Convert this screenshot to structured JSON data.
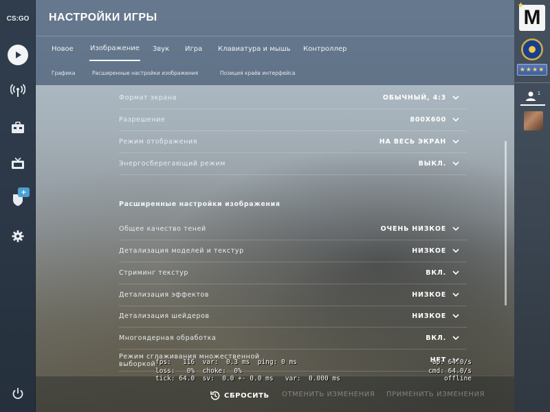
{
  "app": {
    "logo": "CS:GO",
    "page_title": "НАСТРОЙКИ ИГРЫ"
  },
  "left_nav": {
    "items": [
      {
        "icon": "play-icon"
      },
      {
        "icon": "broadcast-icon"
      },
      {
        "icon": "inventory-icon"
      },
      {
        "icon": "tv-icon"
      },
      {
        "icon": "shield-icon",
        "badge": "+"
      },
      {
        "icon": "gear-icon"
      }
    ],
    "power_icon": "power-icon"
  },
  "tabs": [
    {
      "label": "Новое",
      "active": false
    },
    {
      "label": "Изображение",
      "active": true
    },
    {
      "label": "Звук",
      "active": false
    },
    {
      "label": "Игра",
      "active": false
    },
    {
      "label": "Клавиатура и мышь",
      "active": false
    },
    {
      "label": "Контроллер",
      "active": false
    }
  ],
  "subtabs": [
    {
      "label": "Графика"
    },
    {
      "label": "Расширенные настройки изображения"
    },
    {
      "label": "Позиция краёв интерфейса"
    }
  ],
  "basic_settings": [
    {
      "label": "Формат экрана",
      "value": "ОБЫЧНЫЙ, 4:3"
    },
    {
      "label": "Разрешение",
      "value": "800X600"
    },
    {
      "label": "Режим отображения",
      "value": "НА ВЕСЬ ЭКРАН"
    },
    {
      "label": "Энергосберегающий режим",
      "value": "ВЫКЛ."
    }
  ],
  "advanced_section_title": "Расширенные настройки изображения",
  "advanced_settings": [
    {
      "label": "Общее качество теней",
      "value": "ОЧЕНЬ НИЗКОЕ"
    },
    {
      "label": "Детализация моделей и текстур",
      "value": "НИЗКОЕ"
    },
    {
      "label": "Стриминг текстур",
      "value": "ВКЛ."
    },
    {
      "label": "Детализация эффектов",
      "value": "НИЗКОЕ"
    },
    {
      "label": "Детализация шейдеров",
      "value": "НИЗКОЕ"
    },
    {
      "label": "Многоядерная обработка",
      "value": "ВКЛ."
    },
    {
      "label": "Режим сглаживания множественной выборкой",
      "value": "НЕТ"
    }
  ],
  "footer": {
    "reset_label": "СБРОСИТЬ",
    "cancel_label": "ОТМЕНИТЬ ИЗМЕНЕНИЯ",
    "apply_label": "ПРИМЕНИТЬ ИЗМЕНЕНИЯ"
  },
  "right_panel": {
    "profile_letter": "M",
    "rank_stars": "★★★★",
    "friends_count": "1"
  },
  "net_graph": {
    "line1_left": "fps:   116  var:  0.3 ms  ping: 0 ms",
    "line2_left": "loss:   0%  choke:  0%",
    "line3_left": "tick: 64.0  sv:  0.0 +- 0.0 ms   var:  0.000 ms",
    "line1_right": "up: 64.0/s",
    "line2_right": "cmd: 64.0/s",
    "line3_right": "offline"
  },
  "colors": {
    "accent": "#ffffff",
    "badge": "#4aa0d4",
    "nav_bg": "#1e2a3a"
  }
}
